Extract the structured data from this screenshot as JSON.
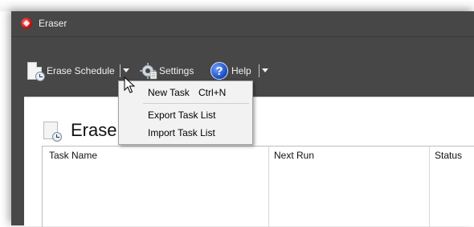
{
  "window": {
    "title": "Eraser"
  },
  "toolbar": {
    "erase_schedule": "Erase Schedule",
    "settings": "Settings",
    "help": "Help"
  },
  "menu": {
    "items": [
      {
        "label": "New Task",
        "shortcut": "Ctrl+N"
      },
      {
        "label": "Export Task List",
        "shortcut": ""
      },
      {
        "label": "Import Task List",
        "shortcut": ""
      }
    ]
  },
  "panel": {
    "title": "Erase",
    "columns": [
      "Task Name",
      "Next Run",
      "Status"
    ]
  },
  "colors": {
    "chrome": "#474747",
    "accent_red": "#c41212",
    "help_blue": "#1b4fc4"
  }
}
